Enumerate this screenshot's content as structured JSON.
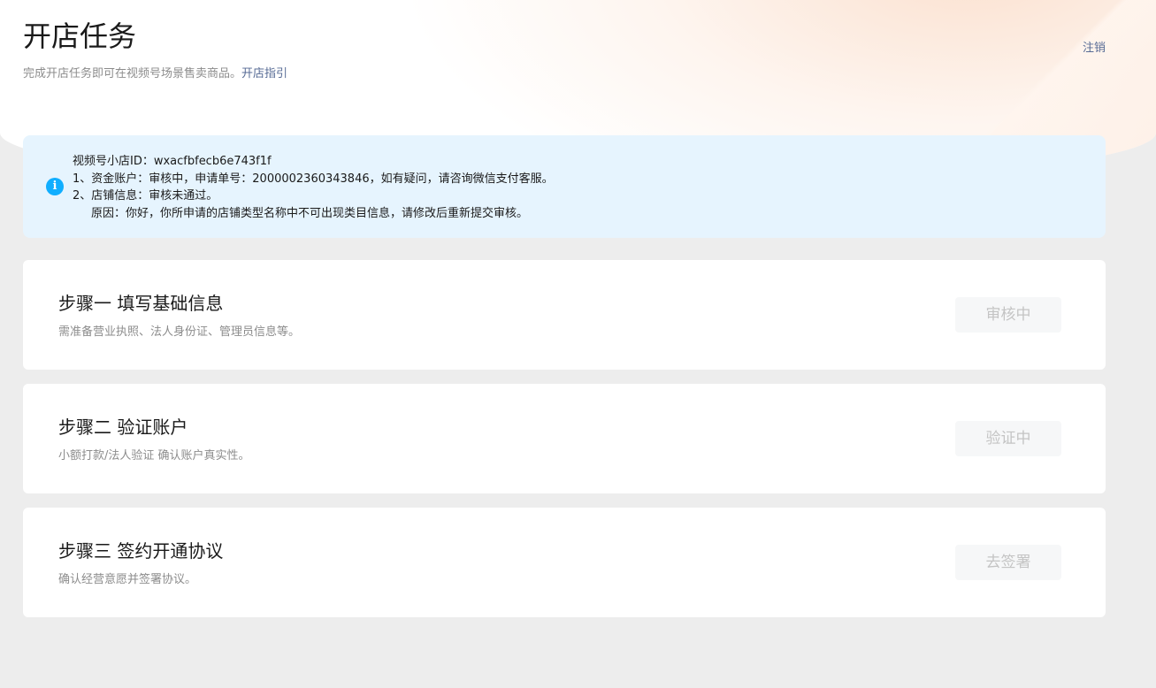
{
  "header": {
    "title": "开店任务",
    "subtitle": "完成开店任务即可在视频号场景售卖商品。",
    "guide_link": "开店指引",
    "logout": "注销"
  },
  "notice": {
    "icon": "info-icon",
    "icon_glyph": "i",
    "icon_color": "#10aeff",
    "shop_id": "视频号小店ID：wxacfbfecb6e743f1f",
    "line1": "1、资金账户：审核中，申请单号：2000002360343846，如有疑问，请咨询微信支付客服。",
    "line2": "2、店铺信息：审核未通过。",
    "line2_reason": "原因：你好，你所申请的店铺类型名称中不可出现类目信息，请修改后重新提交审核。"
  },
  "steps": [
    {
      "title": "步骤一 填写基础信息",
      "desc": "需准备营业执照、法人身份证、管理员信息等。",
      "button": "审核中"
    },
    {
      "title": "步骤二 验证账户",
      "desc": "小额打款/法人验证 确认账户真实性。",
      "button": "验证中"
    },
    {
      "title": "步骤三 签约开通协议",
      "desc": "确认经营意愿并签署协议。",
      "button": "去签署"
    }
  ],
  "colors": {
    "link": "#576b95",
    "notice_bg": "#e6f4fe",
    "page_bg": "#ededed"
  }
}
